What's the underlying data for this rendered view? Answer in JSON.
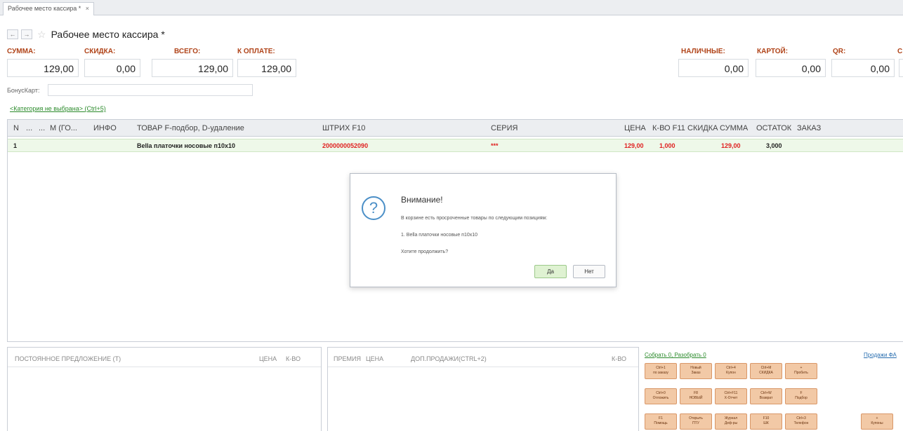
{
  "tab": {
    "label": "Рабочее место кассира *",
    "close": "×"
  },
  "nav": {
    "back": "←",
    "forward": "→",
    "star": "☆"
  },
  "page_title": "Рабочее место кассира *",
  "summary": {
    "sum": {
      "label": "СУММА:",
      "value": "129,00"
    },
    "discount": {
      "label": "СКИДКА:",
      "value": "0,00"
    },
    "total": {
      "label": "ВСЕГО:",
      "value": "129,00"
    },
    "to_pay": {
      "label": "К ОПЛАТЕ:",
      "value": "129,00"
    },
    "cash": {
      "label": "НАЛИЧНЫЕ:",
      "value": "0,00"
    },
    "card": {
      "label": "КАРТОЙ:",
      "value": "0,00"
    },
    "qr": {
      "label": "QR:",
      "value": "0,00"
    },
    "extra": {
      "label": "С"
    }
  },
  "bonus_card": {
    "label": "БонусКарт:",
    "value": ""
  },
  "category_link": "<Категория не выбрана> (Ctrl+5)",
  "grid": {
    "columns": [
      "N",
      "...",
      "...",
      "М (ГО...",
      "ИНФО",
      "ТОВАР F-подбор, D-удаление",
      "ШТРИХ F10",
      "СЕРИЯ",
      "ЦЕНА",
      "К-ВО F11",
      "СКИДКА",
      "СУММА",
      "ОСТАТОК",
      "ЗАКАЗ"
    ],
    "row": {
      "n": "1",
      "product": "Bella платочки носовые п10х10",
      "barcode": "2000000052090",
      "series": "***",
      "price": "129,00",
      "qty": "1,000",
      "sum": "129,00",
      "stock": "3,000"
    }
  },
  "dialog": {
    "icon": "?",
    "title": "Внимание!",
    "line1": "В корзине есть просроченные товары по следующим позициям:",
    "line2": "1. Bella платочки носовые п10х10",
    "line3": "Хотите продолжить?",
    "yes": "Да",
    "no": "Нет"
  },
  "panels": {
    "left": {
      "title": "ПОСТОЯННОЕ ПРЕДЛОЖЕНИЕ (Т)",
      "price": "ЦЕНА",
      "qty": "К-ВО"
    },
    "middle": {
      "premium": "ПРЕМИЯ",
      "price": "ЦЕНА",
      "extra_sales": "ДОП.ПРОДАЖИ(CTRL+2)",
      "qty": "К-ВО"
    }
  },
  "actions": {
    "collect_link": "Собрать 0, Разобрать 0",
    "sales_link": "Продажи ФА",
    "keys": [
      [
        "Ctrl+1",
        "по заказу"
      ],
      [
        "Новый",
        "Заказ"
      ],
      [
        "Ctrl+4",
        "Купон"
      ],
      [
        "Ctrl+M",
        "СКИДКА"
      ],
      [
        "+",
        "Пробить"
      ],
      [
        "Ctrl+0",
        "Отложить"
      ],
      [
        "F8",
        "НОВЫЙ"
      ],
      [
        "Ctrl+F11",
        "X-Отчет"
      ],
      [
        "Ctrl+W",
        "Возврат"
      ],
      [
        "F",
        "Подбор"
      ],
      [
        "F1",
        "Помощь"
      ],
      [
        "Открыть",
        "ПТУ"
      ],
      [
        "Журнал",
        "Деф-ры"
      ],
      [
        "F10",
        "ШК"
      ],
      [
        "Ctrl+3",
        "Телефон"
      ],
      [
        "+",
        "Купоны"
      ]
    ]
  },
  "colors": {
    "accent_label": "#b04318",
    "link_green": "#2a8a2a",
    "key_orange": "#f2c9a6",
    "row_highlight": "#eef8e9",
    "red_value": "#e02020"
  }
}
